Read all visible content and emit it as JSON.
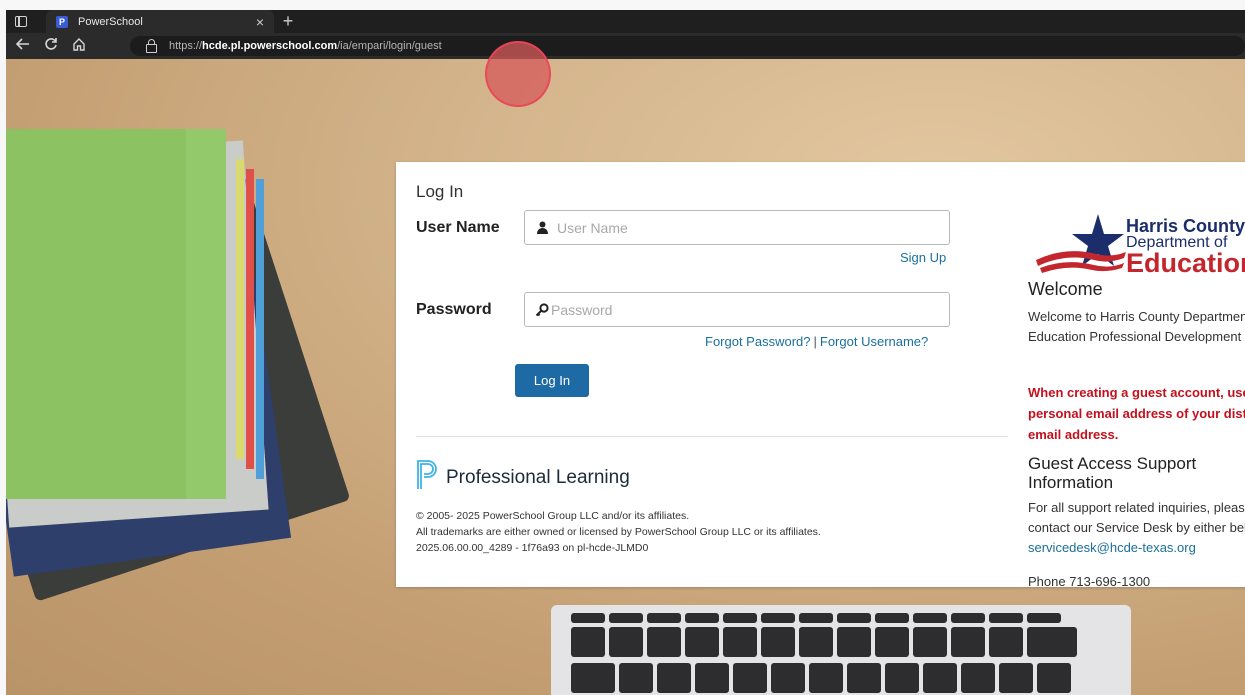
{
  "browser": {
    "tab_title": "PowerSchool",
    "favicon_letter": "P",
    "new_tab": "+",
    "close": "×",
    "url_scheme": "https://",
    "url_host": "hcde.pl.powerschool.com",
    "url_path": "/ia/empari/login/guest"
  },
  "login": {
    "title": "Log In",
    "username_label": "User Name",
    "username_placeholder": "User Name",
    "password_label": "Password",
    "password_placeholder": "Password",
    "signup": "Sign Up",
    "forgot_password": "Forgot Password?",
    "separator": "|",
    "forgot_username": "Forgot Username?",
    "submit": "Log In"
  },
  "footer": {
    "brand": "Professional Learning",
    "copyright": "© 2005- 2025 PowerSchool Group LLC and/or its affiliates.",
    "trademark": "All trademarks are either owned or licensed by PowerSchool Group LLC or its affiliates.",
    "version": "2025.06.00.00_4289 - 1f76a93 on pl-hcde-JLMD0"
  },
  "sidebar": {
    "logo_line1": "Harris County",
    "logo_line2": "Department of",
    "logo_line3": "Education",
    "welcome_heading": "Welcome",
    "welcome_text": "Welcome to Harris County Department of Education Professional Development Center.",
    "warning": "When creating a guest account, use your personal email address of your district email address.",
    "guest_heading": "Guest Access Support Information",
    "guest_text": "For all support related inquiries, please contact our Service Desk by either below.",
    "email": "servicedesk@hcde-texas.org",
    "phone": "Phone 713-696-1300"
  },
  "colors": {
    "primary_button": "#1d6aa5",
    "link": "#1b6f9d",
    "warning": "#c4101d",
    "hcde_blue": "#1b2d6b",
    "hcde_red": "#c4262e"
  }
}
